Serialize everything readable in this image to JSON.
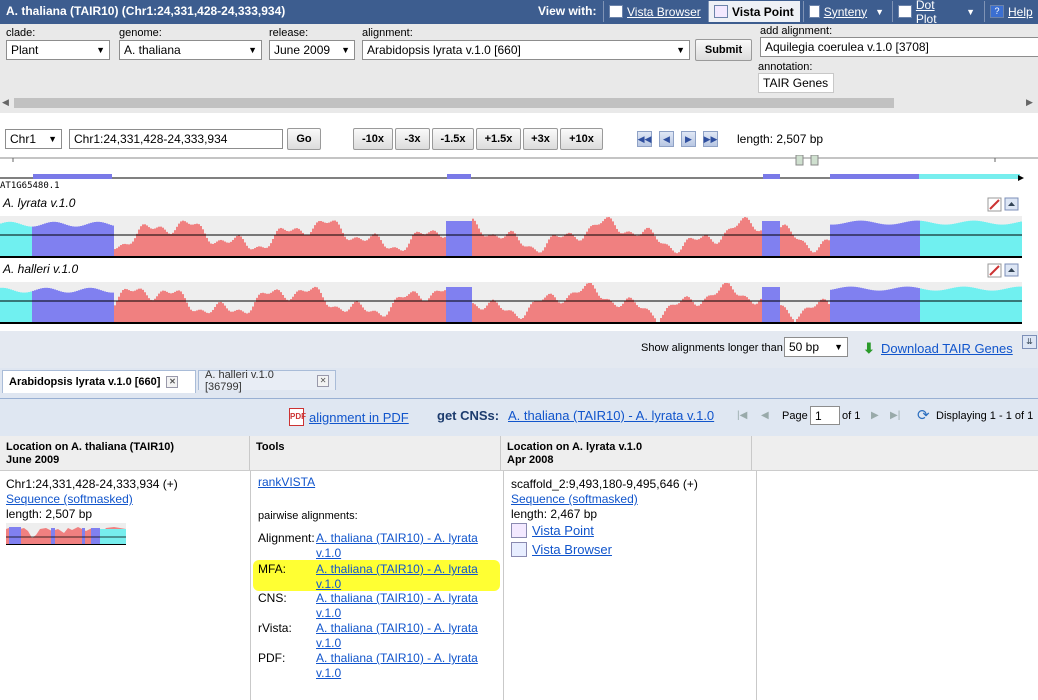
{
  "title_bar": {
    "title": "A. thaliana (TAIR10) (Chr1:24,331,428-24,333,934)",
    "view_with_label": "View with:",
    "tabs": [
      {
        "label": "Vista Browser"
      },
      {
        "label": "Vista Point"
      },
      {
        "label": "Synteny"
      },
      {
        "label": "Dot Plot"
      },
      {
        "label": "Help"
      }
    ]
  },
  "selectors": {
    "clade": {
      "label": "clade:",
      "value": "Plant"
    },
    "genome": {
      "label": "genome:",
      "value": "A. thaliana"
    },
    "release": {
      "label": "release:",
      "value": "June 2009"
    },
    "alignment": {
      "label": "alignment:",
      "value": "Arabidopsis lyrata v.1.0 [660]"
    },
    "submit_label": "Submit",
    "add_alignment": {
      "label": "add alignment:",
      "value": "Aquilegia coerulea v.1.0 [3708]"
    },
    "annotation": {
      "label": "annotation:",
      "value": "TAIR Genes"
    }
  },
  "nav": {
    "chrom": "Chr1",
    "position": "Chr1:24,331,428-24,333,934",
    "go_label": "Go",
    "zoom_buttons": [
      "-10x",
      "-3x",
      "-1.5x",
      "+1.5x",
      "+3x",
      "+10x"
    ],
    "length_text": "length: 2,507 bp"
  },
  "tracks": {
    "gene_label": "AT1G65480.1",
    "track1_label": "A. lyrata v.1.0",
    "track2_label": "A. halleri v.1.0"
  },
  "colors": {
    "exon": "#8080f0",
    "utr": "#70f0f0",
    "cns": "#f08080",
    "title_bar": "#3d5d8f",
    "highlight": "#ffff33"
  },
  "options_bar": {
    "min_len_label": "Show alignments longer than",
    "min_len_value": "50 bp",
    "download_label": "Download TAIR Genes"
  },
  "result_tabs": [
    {
      "label": "Arabidopsis lyrata v.1.0 [660]"
    },
    {
      "label": "A. halleri v.1.0 [36799]"
    }
  ],
  "result_toolbar": {
    "pdf_link": "alignment in PDF",
    "get_cns_label": "get CNSs:",
    "get_cns_link": "A. thaliana (TAIR10) - A. lyrata v.1.0",
    "page_label": "Page",
    "page_value": "1",
    "of_label": "of 1",
    "displaying": "Displaying 1 - 1 of 1"
  },
  "grid": {
    "headers": [
      {
        "line1": "Location on A. thaliana (TAIR10)",
        "line2": "June 2009"
      },
      {
        "line1": "Tools",
        "line2": ""
      },
      {
        "line1": "Location on A. lyrata v.1.0",
        "line2": "Apr 2008"
      }
    ],
    "row": {
      "loc1": "Chr1:24,331,428-24,333,934 (+)",
      "seq1": "Sequence (softmasked)",
      "len1": "length: 2,507 bp",
      "rankvista": "rankVISTA",
      "pairwise_label": "pairwise alignments:",
      "tools": [
        {
          "label": "Alignment:",
          "link1": "A. thaliana (TAIR10) - A. lyrata",
          "link2": "v.1.0"
        },
        {
          "label": "MFA:",
          "link1": "A. thaliana (TAIR10) - A. lyrata",
          "link2": "v.1.0"
        },
        {
          "label": "CNS:",
          "link1": "A. thaliana (TAIR10) - A. lyrata",
          "link2": "v.1.0"
        },
        {
          "label": "rVista:",
          "link1": "A. thaliana (TAIR10) - A. lyrata",
          "link2": "v.1.0"
        },
        {
          "label": "PDF:",
          "link1": "A. thaliana (TAIR10) - A. lyrata",
          "link2": "v.1.0"
        }
      ],
      "loc2": "scaffold_2:9,493,180-9,495,646 (+)",
      "seq2": "Sequence (softmasked)",
      "len2": "length: 2,467 bp",
      "vista_point": "Vista Point",
      "vista_browser": "Vista Browser"
    }
  }
}
